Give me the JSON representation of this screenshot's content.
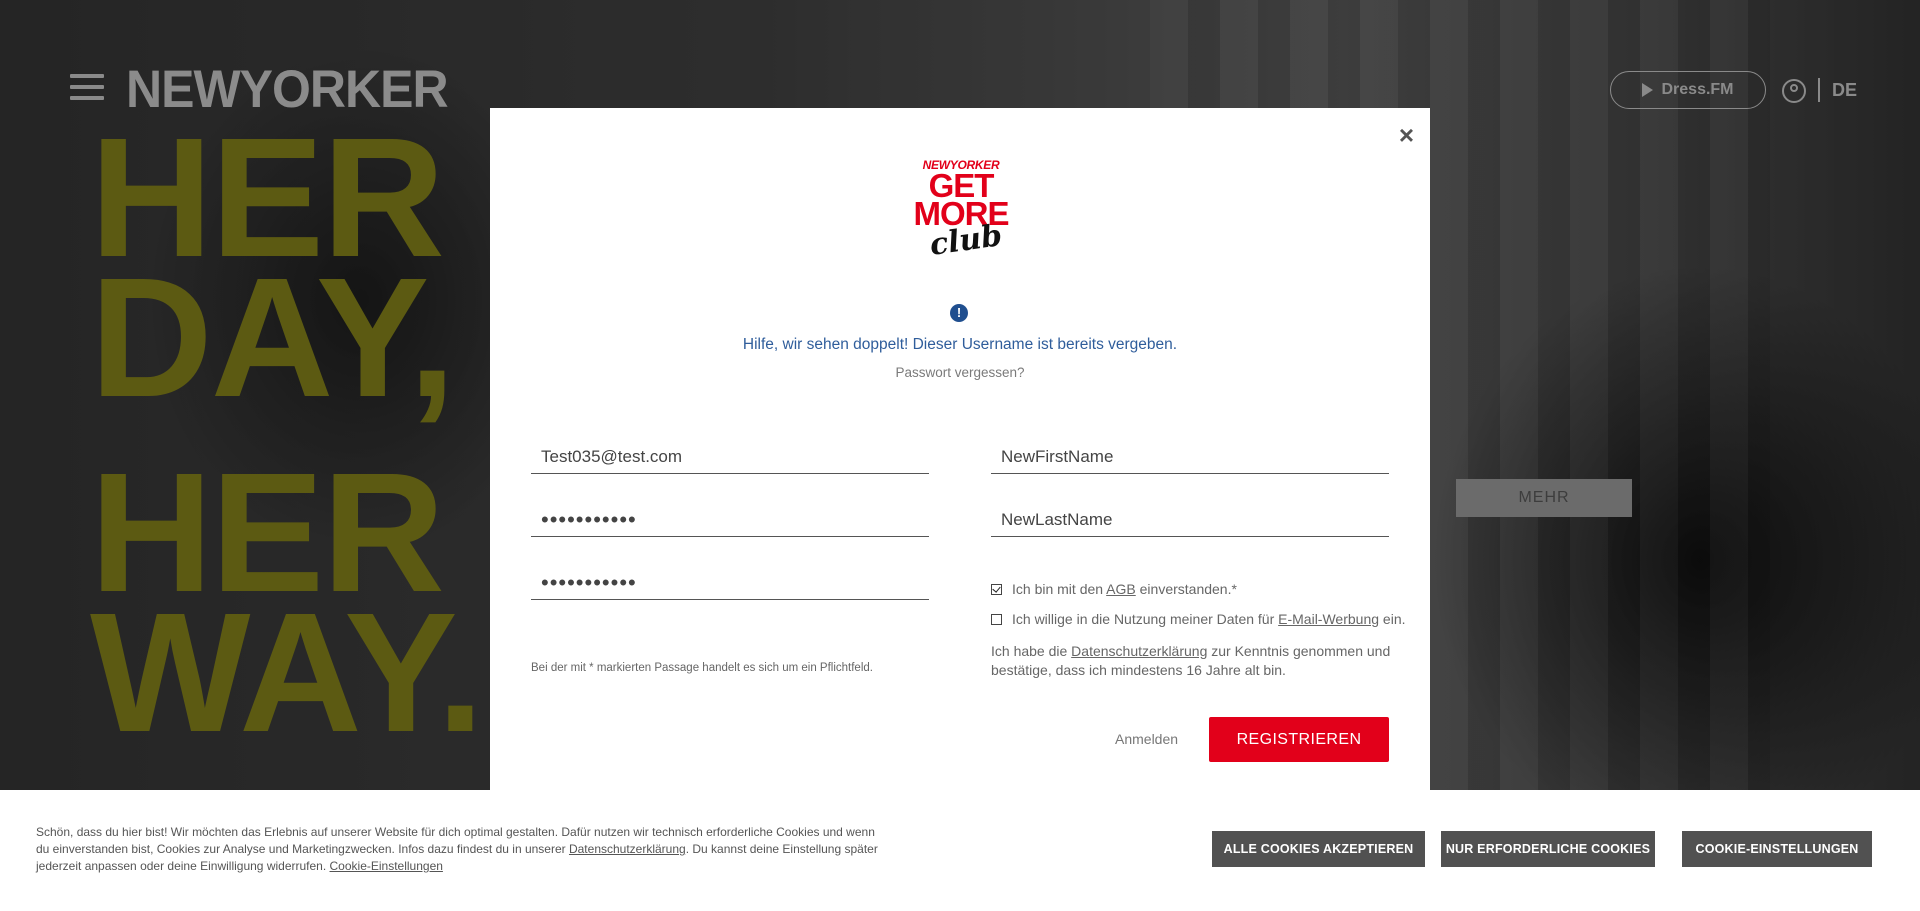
{
  "header": {
    "logo": "NEWYORKER",
    "dressfm_label": "Dress.FM",
    "language": "DE"
  },
  "hero": {
    "line1": "HER",
    "line2": "DAY,",
    "line3": "HER",
    "line4": "WAY.",
    "more_button": "MEHR"
  },
  "modal": {
    "logo_brand": "NEWYORKER",
    "logo_line1": "GET",
    "logo_line2": "MORE",
    "logo_line3": "club",
    "error_message": "Hilfe, wir sehen doppelt! Dieser Username ist bereits vergeben.",
    "forgot_password": "Passwort vergessen?",
    "email_value": "Test035@test.com",
    "password_value": "•••••••••••",
    "password_confirm_value": "•••••••••••",
    "firstname_value": "NewFirstName",
    "lastname_value": "NewLastName",
    "agb_prefix": "Ich bin mit den ",
    "agb_link": "AGB",
    "agb_suffix": " einverstanden.*",
    "agb_checked": true,
    "newsletter_prefix": "Ich willige in die Nutzung meiner Daten für ",
    "newsletter_link": "E-Mail-Werbung",
    "newsletter_suffix": " ein.",
    "newsletter_checked": false,
    "privacy_prefix": "Ich habe die ",
    "privacy_link": "Datenschutzerklärung",
    "privacy_suffix": " zur Kenntnis genommen und bestätige, dass ich mindestens 16 Jahre alt bin.",
    "required_note": "Bei der mit * markierten Passage handelt es sich um ein Pflichtfeld.",
    "login_link": "Anmelden",
    "register_button": "REGISTRIEREN",
    "close": "×"
  },
  "cookie": {
    "text_part1": "Schön, dass du hier bist! Wir möchten das Erlebnis auf unserer Website für dich optimal gestalten. Dafür nutzen wir technisch erforderliche Cookies und wenn du einverstanden bist, Cookies zur Analyse und Marketingzwecken. Infos dazu findest du in unserer ",
    "privacy_link": "Datenschutzerklärung",
    "text_part2": ". Du kannst deine Einstellung später jederzeit anpassen oder deine Einwilligung widerrufen. ",
    "settings_link": "Cookie-Einstellungen",
    "accept_all": "ALLE COOKIES AKZEPTIEREN",
    "necessary_only": "NUR ERFORDERLICHE COOKIES",
    "settings_button": "COOKIE-EINSTELLUNGEN"
  }
}
